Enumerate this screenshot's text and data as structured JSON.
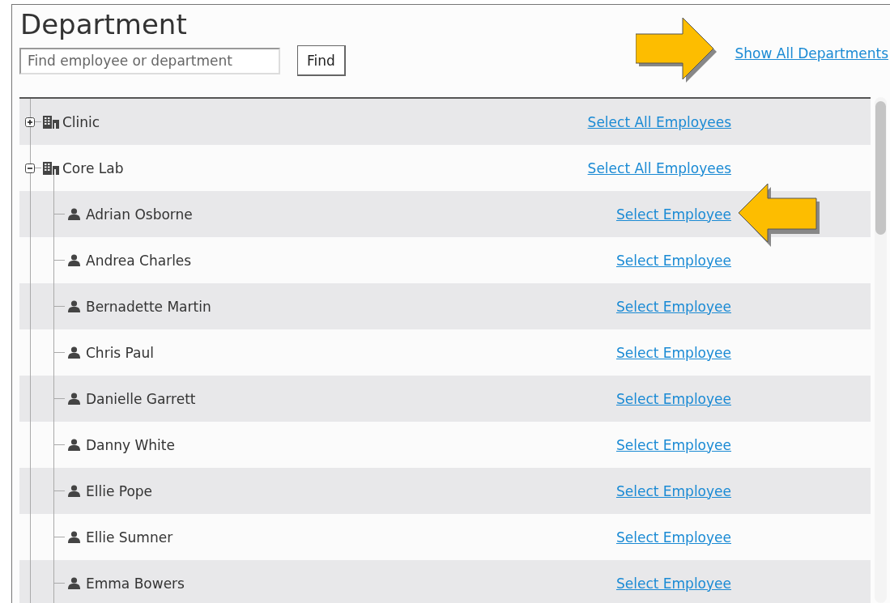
{
  "title": "Department",
  "search": {
    "placeholder": "Find employee or department"
  },
  "find_button": "Find",
  "show_all_link": "Show All Departments",
  "tree": [
    {
      "kind": "department",
      "label": "Clinic",
      "expanded": false,
      "link": "Select All Employees"
    },
    {
      "kind": "department",
      "label": "Core Lab",
      "expanded": true,
      "link": "Select All Employees",
      "children": [
        {
          "kind": "employee",
          "label": "Adrian Osborne",
          "link": "Select Employee"
        },
        {
          "kind": "employee",
          "label": "Andrea Charles",
          "link": "Select Employee"
        },
        {
          "kind": "employee",
          "label": "Bernadette Martin",
          "link": "Select Employee"
        },
        {
          "kind": "employee",
          "label": "Chris Paul",
          "link": "Select Employee"
        },
        {
          "kind": "employee",
          "label": "Danielle Garrett",
          "link": "Select Employee"
        },
        {
          "kind": "employee",
          "label": "Danny White",
          "link": "Select Employee"
        },
        {
          "kind": "employee",
          "label": "Ellie Pope",
          "link": "Select Employee"
        },
        {
          "kind": "employee",
          "label": "Ellie Sumner",
          "link": "Select Employee"
        },
        {
          "kind": "employee",
          "label": "Emma Bowers",
          "link": "Select Employee"
        }
      ]
    }
  ]
}
